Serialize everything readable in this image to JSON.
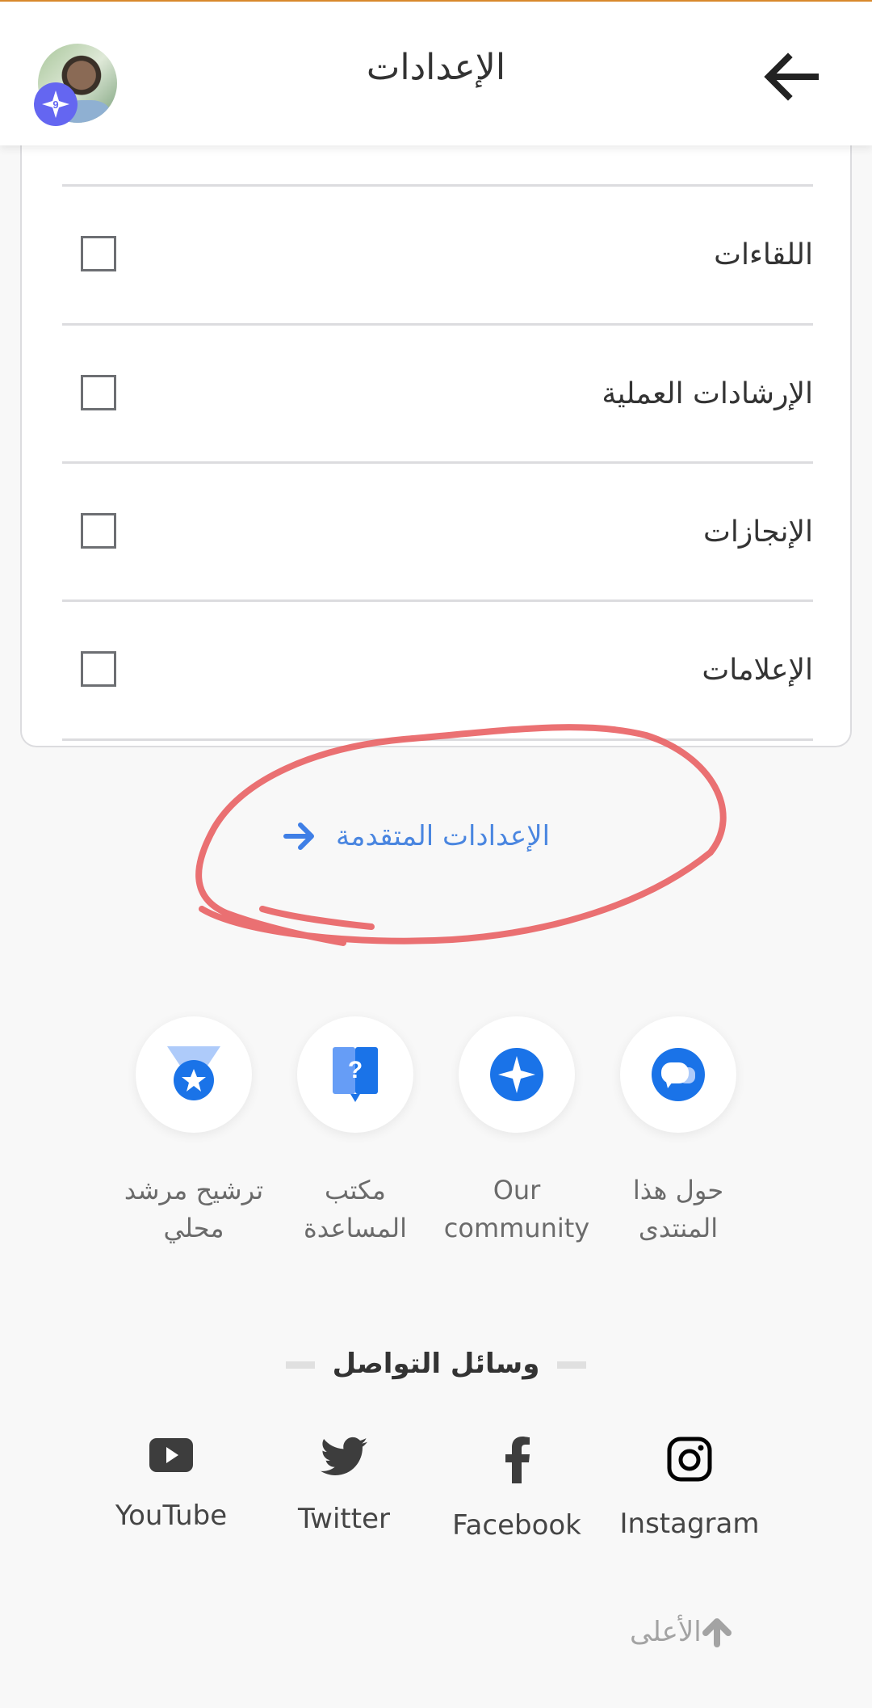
{
  "header": {
    "title": "الإعدادات",
    "back_icon": "arrow-left-icon",
    "avatar_badge_level": "9"
  },
  "settings": {
    "rows": [
      {
        "label": "اللقاءات",
        "checked": false
      },
      {
        "label": "الإرشادات العملية",
        "checked": false
      },
      {
        "label": "الإنجازات",
        "checked": false
      },
      {
        "label": "الإعلامات",
        "checked": false
      }
    ]
  },
  "advanced": {
    "label": "الإعدادات المتقدمة",
    "icon": "arrow-right-icon",
    "color": "#4a86e0",
    "annotation_color": "#e8585a"
  },
  "quick_links": [
    {
      "label_line1": "ترشيح مرشد",
      "label_line2": "محلي",
      "icon": "medal-star-icon"
    },
    {
      "label_line1": "مكتب",
      "label_line2": "المساعدة",
      "icon": "help-question-icon"
    },
    {
      "label_line1": "Our",
      "label_line2": "community",
      "icon": "sparkle-star-icon"
    },
    {
      "label_line1": "حول هذا",
      "label_line2": "المنتدى",
      "icon": "chat-bubbles-icon"
    }
  ],
  "social": {
    "heading": "وسائل التواصل",
    "items": [
      {
        "label": "YouTube",
        "icon": "youtube-icon"
      },
      {
        "label": "Twitter",
        "icon": "twitter-icon"
      },
      {
        "label": "Facebook",
        "icon": "facebook-icon"
      },
      {
        "label": "Instagram",
        "icon": "instagram-icon"
      }
    ]
  },
  "footer": {
    "back_to_top": "الأعلى",
    "icon": "arrow-up-icon"
  },
  "colors": {
    "accent_blue": "#1a73e8",
    "top_bar": "#d8892c",
    "badge": "#6466f1"
  }
}
